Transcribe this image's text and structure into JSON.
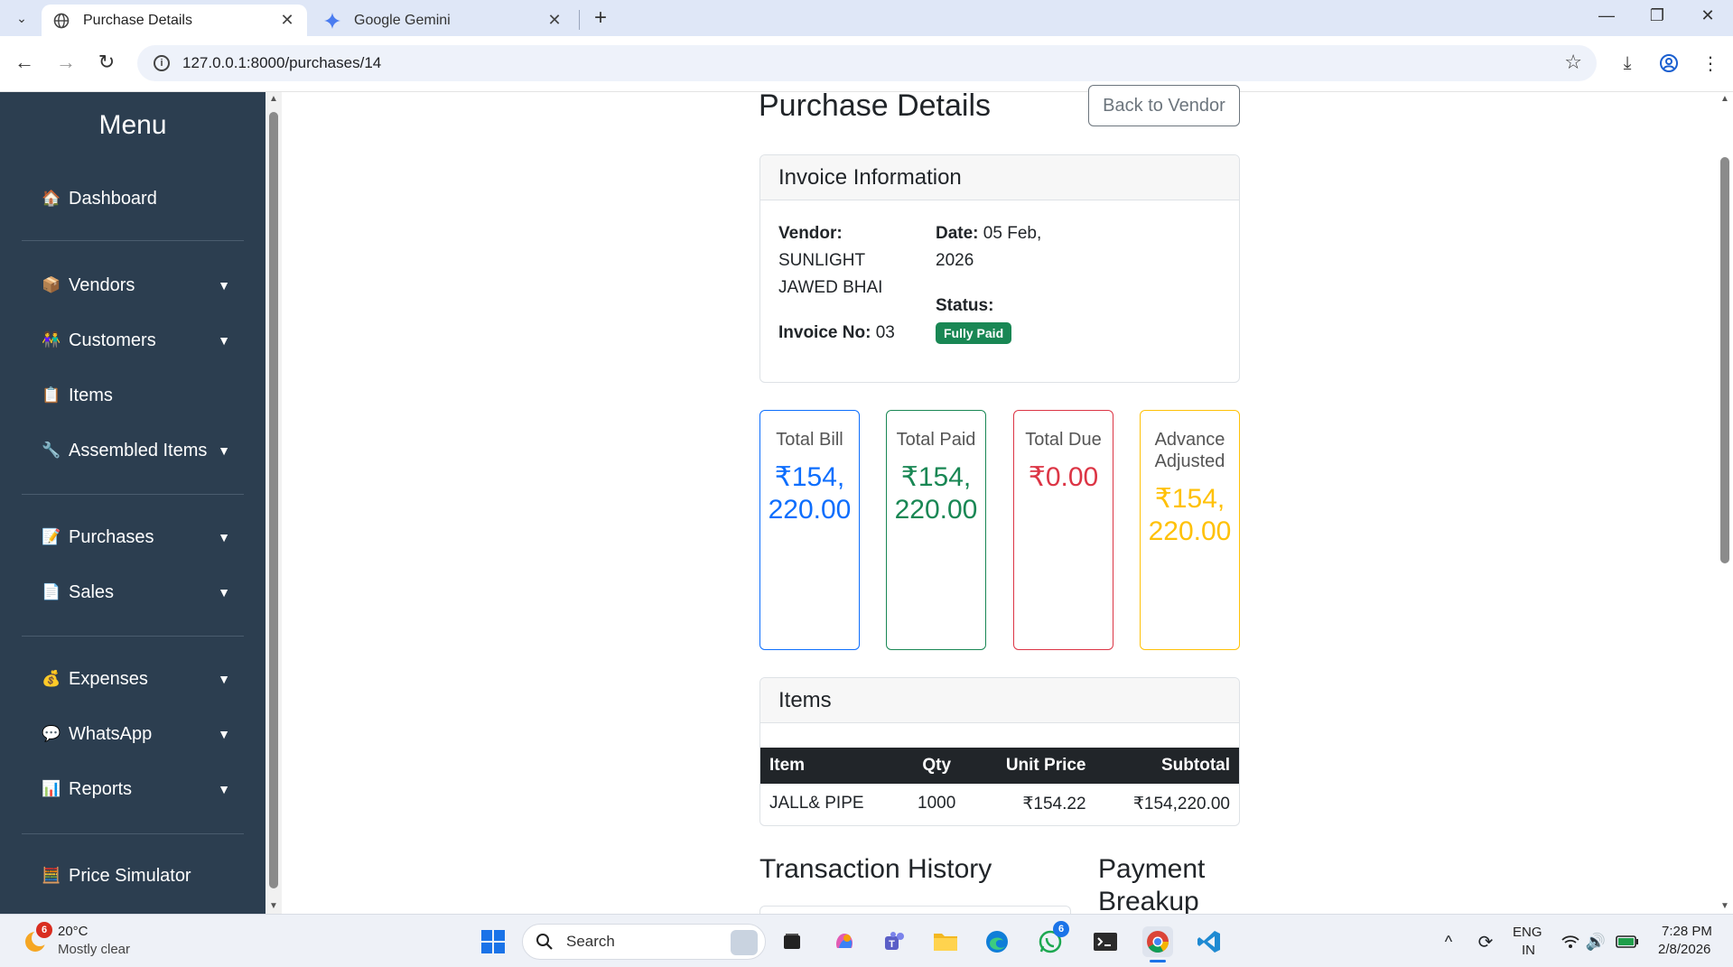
{
  "browser": {
    "tabs": [
      {
        "title": "Purchase Details",
        "active": true
      },
      {
        "title": "Google Gemini",
        "active": false
      }
    ],
    "url": "127.0.0.1:8000/purchases/14"
  },
  "sidebar": {
    "title": "Menu",
    "items": [
      {
        "icon": "🏠",
        "label": "Dashboard"
      },
      {
        "icon": "📦",
        "label": "Vendors"
      },
      {
        "icon": "👫",
        "label": "Customers"
      },
      {
        "icon": "📋",
        "label": "Items"
      },
      {
        "icon": "🔧",
        "label": "Assembled Items"
      },
      {
        "icon": "📝",
        "label": "Purchases"
      },
      {
        "icon": "📄",
        "label": "Sales"
      },
      {
        "icon": "💰",
        "label": "Expenses"
      },
      {
        "icon": "💬",
        "label": "WhatsApp"
      },
      {
        "icon": "📊",
        "label": "Reports"
      },
      {
        "icon": "🧮",
        "label": "Price Simulator"
      }
    ],
    "caret": "▼"
  },
  "page": {
    "title": "Purchase Details",
    "back_button": "Back to Vendor"
  },
  "invoice": {
    "header": "Invoice Information",
    "vendor_label": "Vendor:",
    "vendor_line1": "SUNLIGHT",
    "vendor_line2": "JAWED BHAI",
    "invoice_no_label": "Invoice No:",
    "invoice_no": "03",
    "date_label": "Date:",
    "date_line1": "05 Feb,",
    "date_line2": "2026",
    "status_label": "Status:",
    "status": "Fully Paid"
  },
  "summary": [
    {
      "label": "Total Bill",
      "value": "₹154,220.00",
      "color": "#0d6efd"
    },
    {
      "label": "Total Paid",
      "value": "₹154,220.00",
      "color": "#198754"
    },
    {
      "label": "Total Due",
      "value": "₹0.00",
      "color": "#dc3545"
    },
    {
      "label": "Advance Adjusted",
      "value": "₹154,220.00",
      "color": "#ffc107"
    }
  ],
  "items": {
    "header": "Items",
    "columns": [
      "Item",
      "Qty",
      "Unit Price",
      "Subtotal"
    ],
    "rows": [
      [
        "JALL& PIPE",
        "1000",
        "₹154.22",
        "₹154,220.00"
      ]
    ]
  },
  "sections": {
    "transactions": "Transaction History",
    "payment_breakup": "Payment Breakup"
  },
  "taskbar": {
    "weather_temp": "20°C",
    "weather_desc": "Mostly clear",
    "weather_badge": "6",
    "search": "Search",
    "whatsapp_badge": "6",
    "lang_line1": "ENG",
    "lang_line2": "IN",
    "time": "7:28 PM",
    "date": "2/8/2026"
  }
}
